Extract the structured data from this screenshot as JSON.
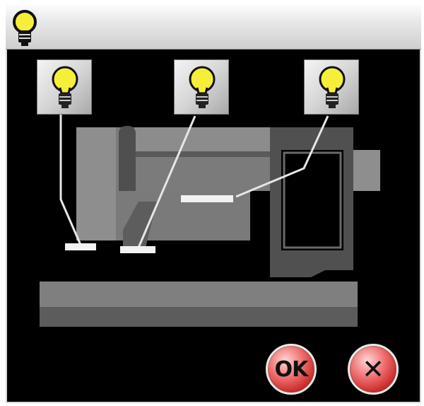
{
  "window": {
    "title_icon": "lightbulb-icon"
  },
  "light_buttons": [
    {
      "icon": "lightbulb-icon",
      "state": "on"
    },
    {
      "icon": "lightbulb-icon",
      "state": "on"
    },
    {
      "icon": "lightbulb-icon",
      "state": "on"
    }
  ],
  "actions": {
    "ok_label": "OK",
    "close_label": "✕"
  },
  "colors": {
    "bulb": "#f5ef3a",
    "background": "#000000",
    "machine_light": "#8a8a8a",
    "button_red": "#d93a3a"
  }
}
